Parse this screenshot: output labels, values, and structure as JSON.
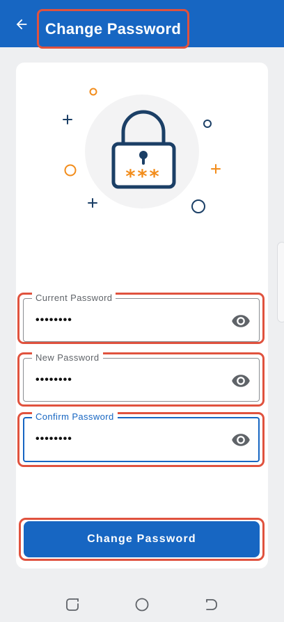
{
  "header": {
    "title": "Change Password",
    "back_icon": "arrow-left-icon",
    "color": "#1766c2"
  },
  "illustration": {
    "icon": "lock-icon",
    "password_mask": "***",
    "decorations": [
      "plus-icon",
      "circle-icon"
    ]
  },
  "form": {
    "current_password": {
      "label": "Current Password",
      "value": "••••••••",
      "toggle_icon": "eye-icon"
    },
    "new_password": {
      "label": "New Password",
      "value": "••••••••",
      "toggle_icon": "eye-icon"
    },
    "confirm_password": {
      "label": "Confirm Password",
      "value": "••••••••",
      "toggle_icon": "eye-icon",
      "focused": true
    }
  },
  "submit_button": {
    "label": "Change Password"
  },
  "system_nav": {
    "items": [
      "recent-apps-icon",
      "home-icon",
      "back-icon"
    ]
  },
  "colors": {
    "primary": "#1766c2",
    "accent": "#f28c1a",
    "highlight": "#e0523e"
  }
}
